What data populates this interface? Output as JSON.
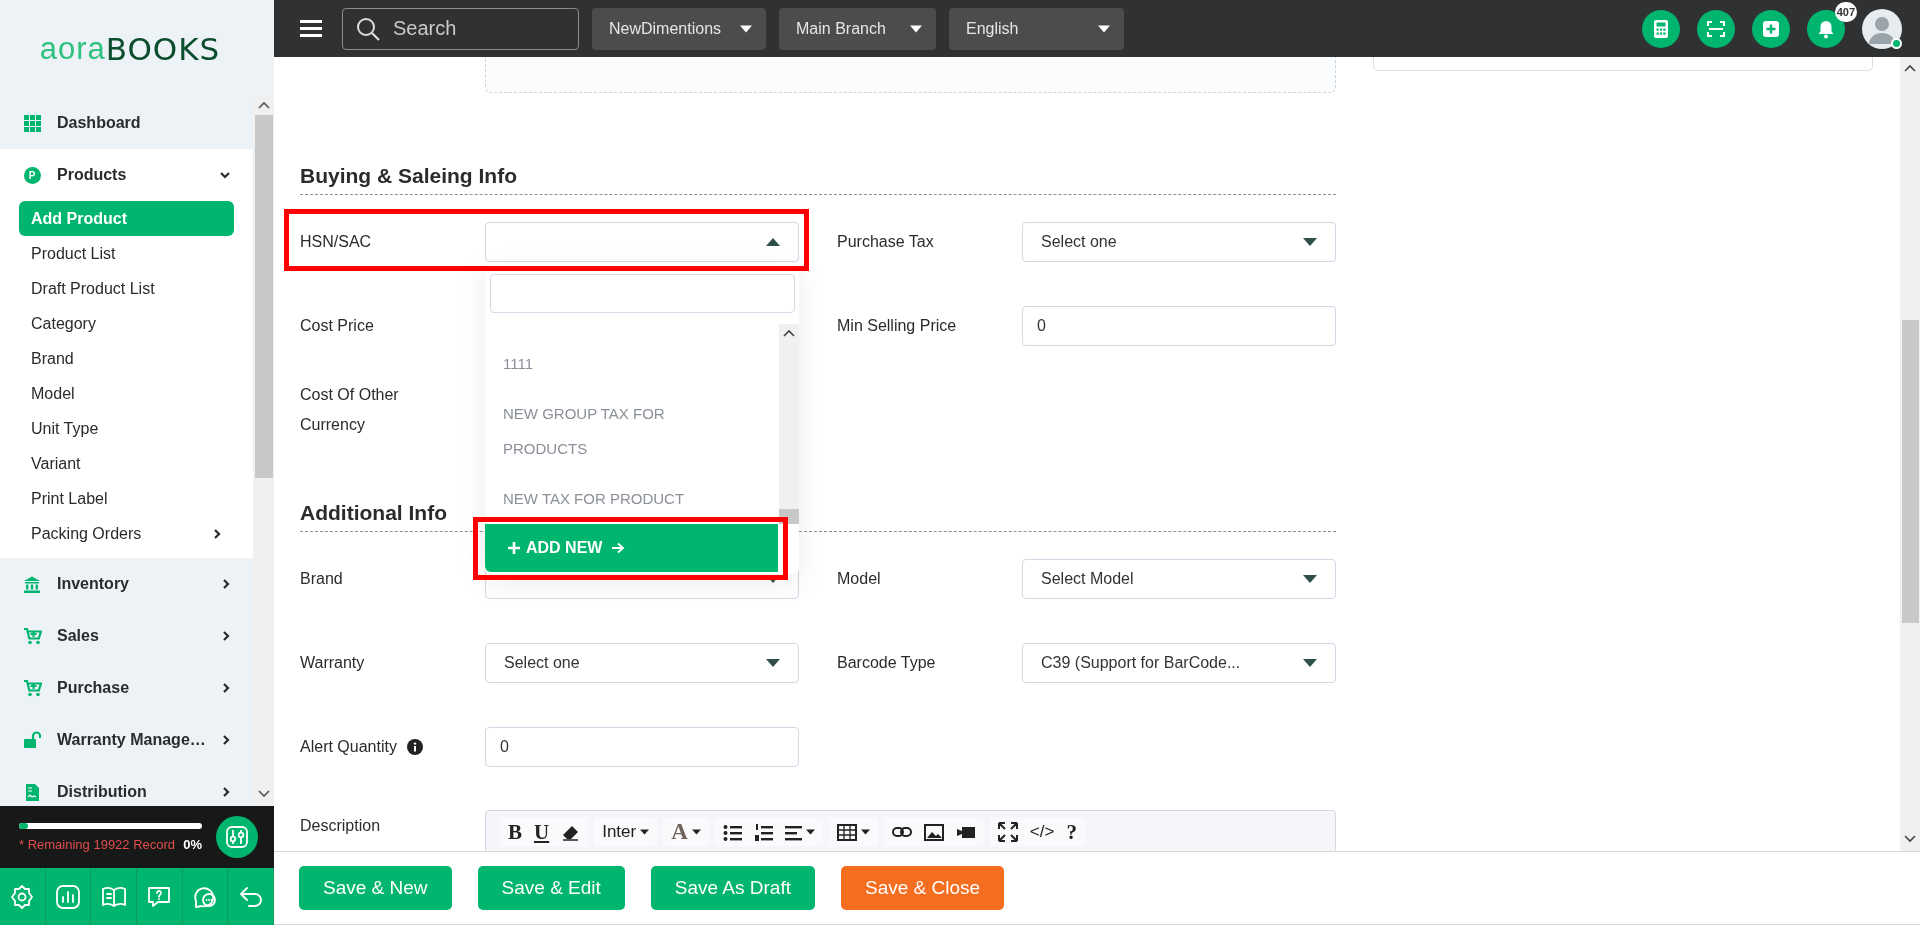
{
  "logo": {
    "left": "aora",
    "right": "BOOKS"
  },
  "topbar": {
    "search": {
      "placeholder": "Search"
    },
    "selectors": [
      {
        "label": "NewDimentions"
      },
      {
        "label": "Main Branch"
      },
      {
        "label": "English"
      }
    ],
    "notification_count": "407",
    "user": {
      "online": true
    }
  },
  "sidebar": {
    "items": [
      {
        "label": "Dashboard",
        "kind": "link",
        "selected": false
      },
      {
        "label": "Products",
        "kind": "group",
        "badge": "P",
        "selected": false,
        "expanded": true,
        "children": [
          {
            "label": "Add Product",
            "kind": "link",
            "selected": true
          },
          {
            "label": "Product List",
            "kind": "link",
            "selected": false
          },
          {
            "label": "Draft Product List",
            "kind": "link",
            "selected": false
          },
          {
            "label": "Category",
            "kind": "link",
            "selected": false
          },
          {
            "label": "Brand",
            "kind": "link",
            "selected": false
          },
          {
            "label": "Model",
            "kind": "link",
            "selected": false
          },
          {
            "label": "Unit Type",
            "kind": "link",
            "selected": false
          },
          {
            "label": "Variant",
            "kind": "link",
            "selected": false
          },
          {
            "label": "Print Label",
            "kind": "link",
            "selected": false
          },
          {
            "label": "Packing Orders",
            "kind": "group",
            "selected": false,
            "expanded": false
          }
        ]
      },
      {
        "label": "Inventory",
        "kind": "group",
        "selected": false,
        "expanded": false
      },
      {
        "label": "Sales",
        "kind": "group",
        "selected": false,
        "expanded": false
      },
      {
        "label": "Purchase",
        "kind": "group",
        "selected": false,
        "expanded": false
      },
      {
        "label": "Warranty Manage…",
        "kind": "group",
        "selected": false,
        "expanded": false
      },
      {
        "label": "Distribution",
        "kind": "group",
        "selected": false,
        "expanded": false
      }
    ]
  },
  "record_quota": {
    "text": "* Remaining 19922 Record",
    "percent": "0%",
    "level": 0.05
  },
  "form": {
    "sections": [
      {
        "title": "Buying & Saleing Info",
        "rows": [
          [
            {
              "label": "HSN/SAC",
              "kind": "select",
              "open": true,
              "highlighted": true
            },
            {
              "label": "Purchase Tax",
              "kind": "select",
              "value": "Select one",
              "open": false
            }
          ],
          [
            {
              "label": "Cost Price",
              "kind": "label_only"
            },
            {
              "label": "Min Selling Price",
              "kind": "input",
              "value": "0"
            }
          ],
          [
            {
              "label": "Cost Of Other Currency",
              "kind": "label_only"
            }
          ]
        ]
      },
      {
        "title": "Additional Info",
        "rows": [
          [
            {
              "label": "Brand",
              "kind": "select",
              "open": false
            },
            {
              "label": "Model",
              "kind": "select",
              "value": "Select Model",
              "open": false
            }
          ],
          [
            {
              "label": "Warranty",
              "kind": "select",
              "value": "Select one",
              "open": false
            },
            {
              "label": "Barcode Type",
              "kind": "select",
              "value": "C39 (Support for BarCode...",
              "open": false
            }
          ],
          [
            {
              "label": "Alert Quantity",
              "kind": "input",
              "value": "0",
              "info": true
            }
          ],
          [
            {
              "label": "Description",
              "kind": "editor",
              "toolbar": [
                "B",
                "U",
                "Inter",
                "A",
                "</>",
                "?"
              ]
            }
          ]
        ]
      }
    ],
    "hsn_dropdown": {
      "options": [
        {
          "label": "1111"
        },
        {
          "label": "NEW GROUP TAX FOR PRODUCTS"
        },
        {
          "label": "NEW TAX FOR PRODUCT"
        }
      ],
      "add_new": {
        "label": "ADD NEW",
        "highlighted": true
      }
    }
  },
  "actions": [
    {
      "label": "Save & New",
      "kind": "primary"
    },
    {
      "label": "Save & Edit",
      "kind": "primary"
    },
    {
      "label": "Save As Draft",
      "kind": "primary"
    },
    {
      "label": "Save & Close",
      "kind": "danger"
    }
  ]
}
